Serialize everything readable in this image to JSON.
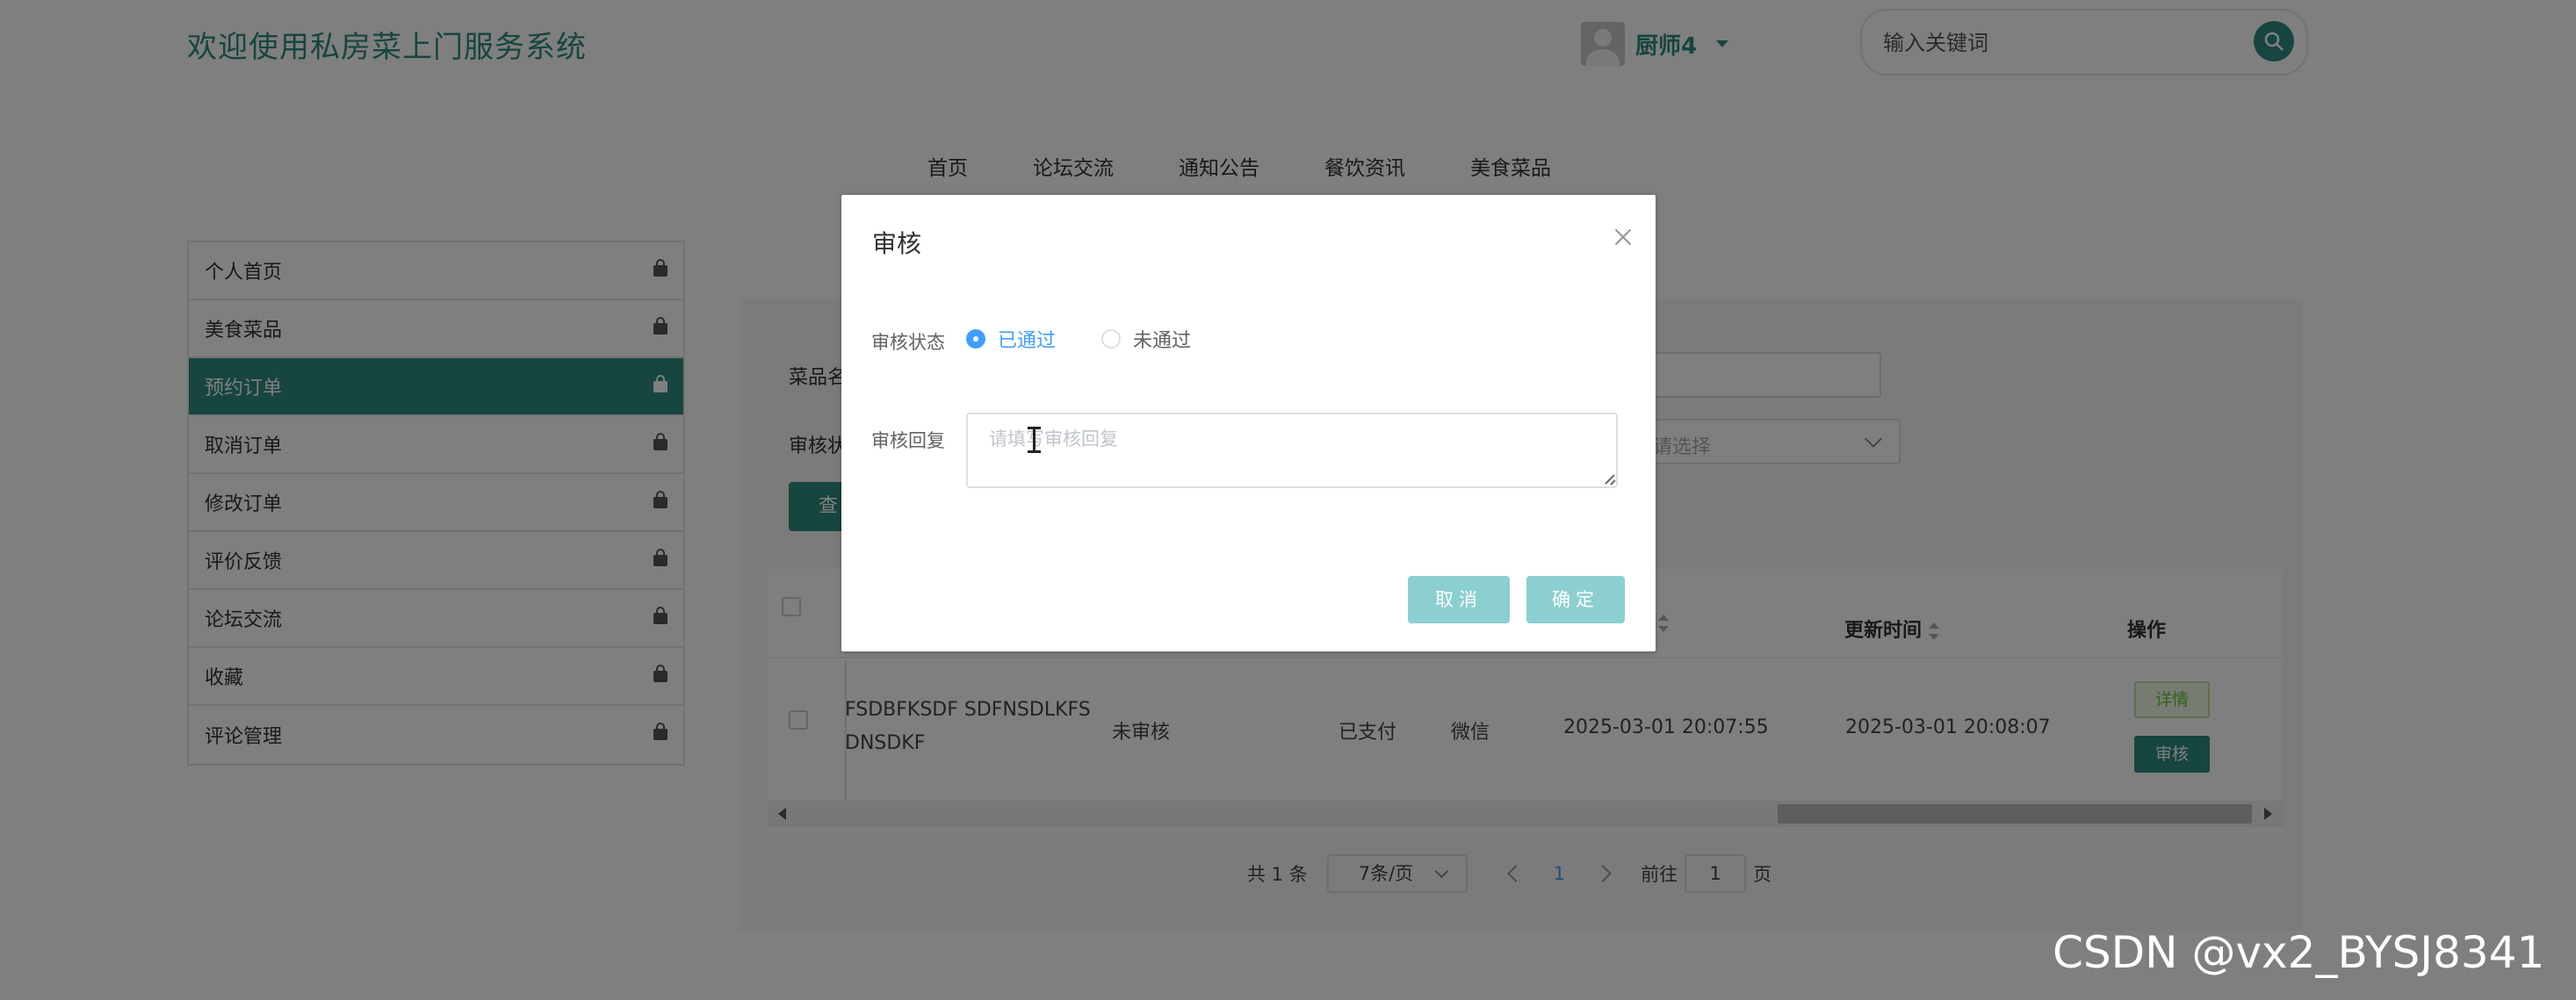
{
  "site": {
    "title": "欢迎使用私房菜上门服务系统",
    "user_name": "厨师4",
    "search_placeholder": "输入关键词"
  },
  "nav": [
    "首页",
    "论坛交流",
    "通知公告",
    "餐饮资讯",
    "美食菜品"
  ],
  "sidebar": {
    "items": [
      {
        "label": "个人首页"
      },
      {
        "label": "美食菜品"
      },
      {
        "label": "预约订单",
        "active": true
      },
      {
        "label": "取消订单"
      },
      {
        "label": "修改订单"
      },
      {
        "label": "评价反馈"
      },
      {
        "label": "论坛交流"
      },
      {
        "label": "收藏"
      },
      {
        "label": "评论管理"
      }
    ]
  },
  "filters": {
    "name_label": "菜品名",
    "status_label": "审核状",
    "status_placeholder": "请选择",
    "query_label": "查"
  },
  "table": {
    "headers": {
      "update_time": "更新时间",
      "action": "操作"
    },
    "row": {
      "name": "FSDBFKSDF SDFNSDLKFS DNSDKF",
      "audit_status": "未审核",
      "pay_status": "已支付",
      "pay_method": "微信",
      "create_time": "2025-03-01 20:07:55",
      "update_time": "2025-03-01 20:08:07",
      "detail_label": "详情",
      "audit_label": "审核"
    }
  },
  "pagination": {
    "total": "共 1 条",
    "page_size": "7条/页",
    "current": "1",
    "goto_label": "前往",
    "goto_value": "1",
    "page_suffix": "页"
  },
  "dialog": {
    "title": "审核",
    "status_label": "审核状态",
    "options": [
      {
        "label": "已通过",
        "checked": true
      },
      {
        "label": "未通过",
        "checked": false
      }
    ],
    "reply_label": "审核回复",
    "reply_placeholder": "请填写审核回复",
    "cancel_label": "取消",
    "confirm_label": "确定"
  },
  "watermark": "CSDN @vx2_BYSJ8341",
  "colors": {
    "accent": "#2e8b80",
    "radio_active": "#409eff",
    "dialog_button": "#8ccfd0"
  }
}
